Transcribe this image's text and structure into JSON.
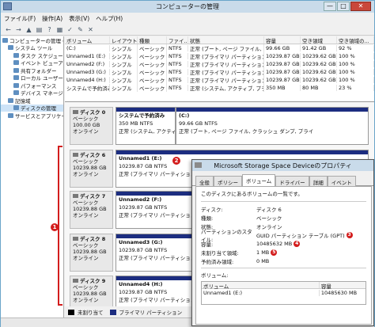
{
  "window": {
    "title": "コンピューターの管理",
    "min": "—",
    "max": "□",
    "close": "✕"
  },
  "menu": [
    "ファイル(F)",
    "操作(A)",
    "表示(V)",
    "ヘルプ(H)"
  ],
  "toolbar": [
    "←",
    "→",
    "▲",
    "▤",
    "?",
    "▦",
    "✓",
    "✎",
    "✕"
  ],
  "sidebar": {
    "items": [
      {
        "label": "コンピューターの管理 (ローカル)",
        "indent": 0,
        "selected": false
      },
      {
        "label": "システム ツール",
        "indent": 1,
        "selected": false
      },
      {
        "label": "タスク スケジューラ",
        "indent": 2,
        "selected": false
      },
      {
        "label": "イベント ビューアー",
        "indent": 2,
        "selected": false
      },
      {
        "label": "共有フォルダー",
        "indent": 2,
        "selected": false
      },
      {
        "label": "ローカル ユーザーとグループ",
        "indent": 2,
        "selected": false
      },
      {
        "label": "パフォーマンス",
        "indent": 2,
        "selected": false
      },
      {
        "label": "デバイス マネージャー",
        "indent": 2,
        "selected": false
      },
      {
        "label": "記憶域",
        "indent": 1,
        "selected": false
      },
      {
        "label": "ディスクの管理",
        "indent": 2,
        "selected": true
      },
      {
        "label": "サービスとアプリケーション",
        "indent": 1,
        "selected": false
      }
    ]
  },
  "volume_list": {
    "headers": [
      "ボリューム",
      "レイアウト",
      "種類",
      "ファイ...",
      "状態",
      "容量",
      "空き領域",
      "空き領域の..."
    ],
    "rows": [
      [
        "(C:)",
        "シンプル",
        "ベーシック",
        "NTFS",
        "正常 (ブート, ページ ファイル, ...",
        "99.66 GB",
        "91.42 GB",
        "92 %"
      ],
      [
        "Unnamed1 (E:)",
        "シンプル",
        "ベーシック",
        "NTFS",
        "正常 (プライマリ パーティション)",
        "10239.87 GB",
        "10239.62 GB",
        "100 %"
      ],
      [
        "Unnamed2 (F:)",
        "シンプル",
        "ベーシック",
        "NTFS",
        "正常 (プライマリ パーティション)",
        "10239.87 GB",
        "10239.62 GB",
        "100 %"
      ],
      [
        "Unnamed3 (G:)",
        "シンプル",
        "ベーシック",
        "NTFS",
        "正常 (プライマリ パーティション)",
        "10239.87 GB",
        "10239.62 GB",
        "100 %"
      ],
      [
        "Unnamed4 (H:)",
        "シンプル",
        "ベーシック",
        "NTFS",
        "正常 (プライマリ パーティション)",
        "10239.87 GB",
        "10239.62 GB",
        "100 %"
      ],
      [
        "システムで予約済み",
        "シンプル",
        "ベーシック",
        "NTFS",
        "正常 (システム, アクティブ, プライマ...",
        "350 MB",
        "80 MB",
        "23 %"
      ]
    ]
  },
  "disks": [
    {
      "name": "ディスク 0",
      "type": "ベーシック",
      "size": "100.00 GB",
      "status": "オンライン",
      "parts": [
        {
          "name": "システムで予約済み",
          "size": "350 MB NTFS",
          "status": "正常 (システム, アクティブ"
        },
        {
          "name": "(C:)",
          "size": "99.66 GB NTFS",
          "status": "正常 (ブート, ページ ファイル, クラッシュ ダンプ, プライ"
        }
      ]
    },
    {
      "name": "ディスク 6",
      "type": "ベーシック",
      "size": "10239.88 GB",
      "status": "オンライン",
      "parts": [
        {
          "name": "Unnamed1 (E:)",
          "size": "10239.87 GB NTFS",
          "status": "正常 (プライマリ パーティション)"
        }
      ]
    },
    {
      "name": "ディスク 7",
      "type": "ベーシック",
      "size": "10239.88 GB",
      "status": "オンライン",
      "parts": [
        {
          "name": "Unnamed2 (F:)",
          "size": "10239.87 GB NTFS",
          "status": "正常 (プライマリ パーティション)"
        }
      ]
    },
    {
      "name": "ディスク 8",
      "type": "ベーシック",
      "size": "10239.88 GB",
      "status": "オンライン",
      "parts": [
        {
          "name": "Unnamed3 (G:)",
          "size": "10239.87 GB NTFS",
          "status": "正常 (プライマリ パーティション)"
        }
      ]
    },
    {
      "name": "ディスク 9",
      "type": "ベーシック",
      "size": "10239.88 GB",
      "status": "オンライン",
      "parts": [
        {
          "name": "Unnamed4 (H:)",
          "size": "10239.87 GB NTFS",
          "status": "正常 (プライマリ パーティション)"
        }
      ]
    }
  ],
  "legend": {
    "unallocated": "未割り当て",
    "primary": "プライマリ パーティション"
  },
  "badges": {
    "b1": "1",
    "b2": "2",
    "b3": "3",
    "b4": "4",
    "b5": "5"
  },
  "dialog": {
    "title": "Microsoft Storage Space Deviceのプロパティ",
    "tabs": [
      "全般",
      "ポリシー",
      "ボリューム",
      "ドライバー",
      "詳細",
      "イベント"
    ],
    "active_tab": 2,
    "intro": "このディスクにあるボリュームの一覧です。",
    "props": [
      {
        "k": "ディスク:",
        "v": "ディスク 6",
        "badge": ""
      },
      {
        "k": "種類:",
        "v": "ベーシック",
        "badge": ""
      },
      {
        "k": "状態:",
        "v": "オンライン",
        "badge": ""
      },
      {
        "k": "パーティションのスタイル:",
        "v": "GUID パーティション テーブル (GPT)",
        "badge": "3"
      },
      {
        "k": "容量:",
        "v": "10485632 MB",
        "badge": "4"
      },
      {
        "k": "未割り当て領域:",
        "v": "1 MB",
        "badge": "5"
      },
      {
        "k": "予約済み領域:",
        "v": "0 MB",
        "badge": ""
      }
    ],
    "volumes_label": "ボリューム:",
    "vol_headers": [
      "ボリューム",
      "容量"
    ],
    "vol_rows": [
      [
        "Unnamed1 (E:)",
        "10485630 MB"
      ]
    ]
  },
  "colors": {
    "primary_bar": "#1c2d80",
    "badge": "#d31d1d",
    "unallocated": "#000000"
  }
}
